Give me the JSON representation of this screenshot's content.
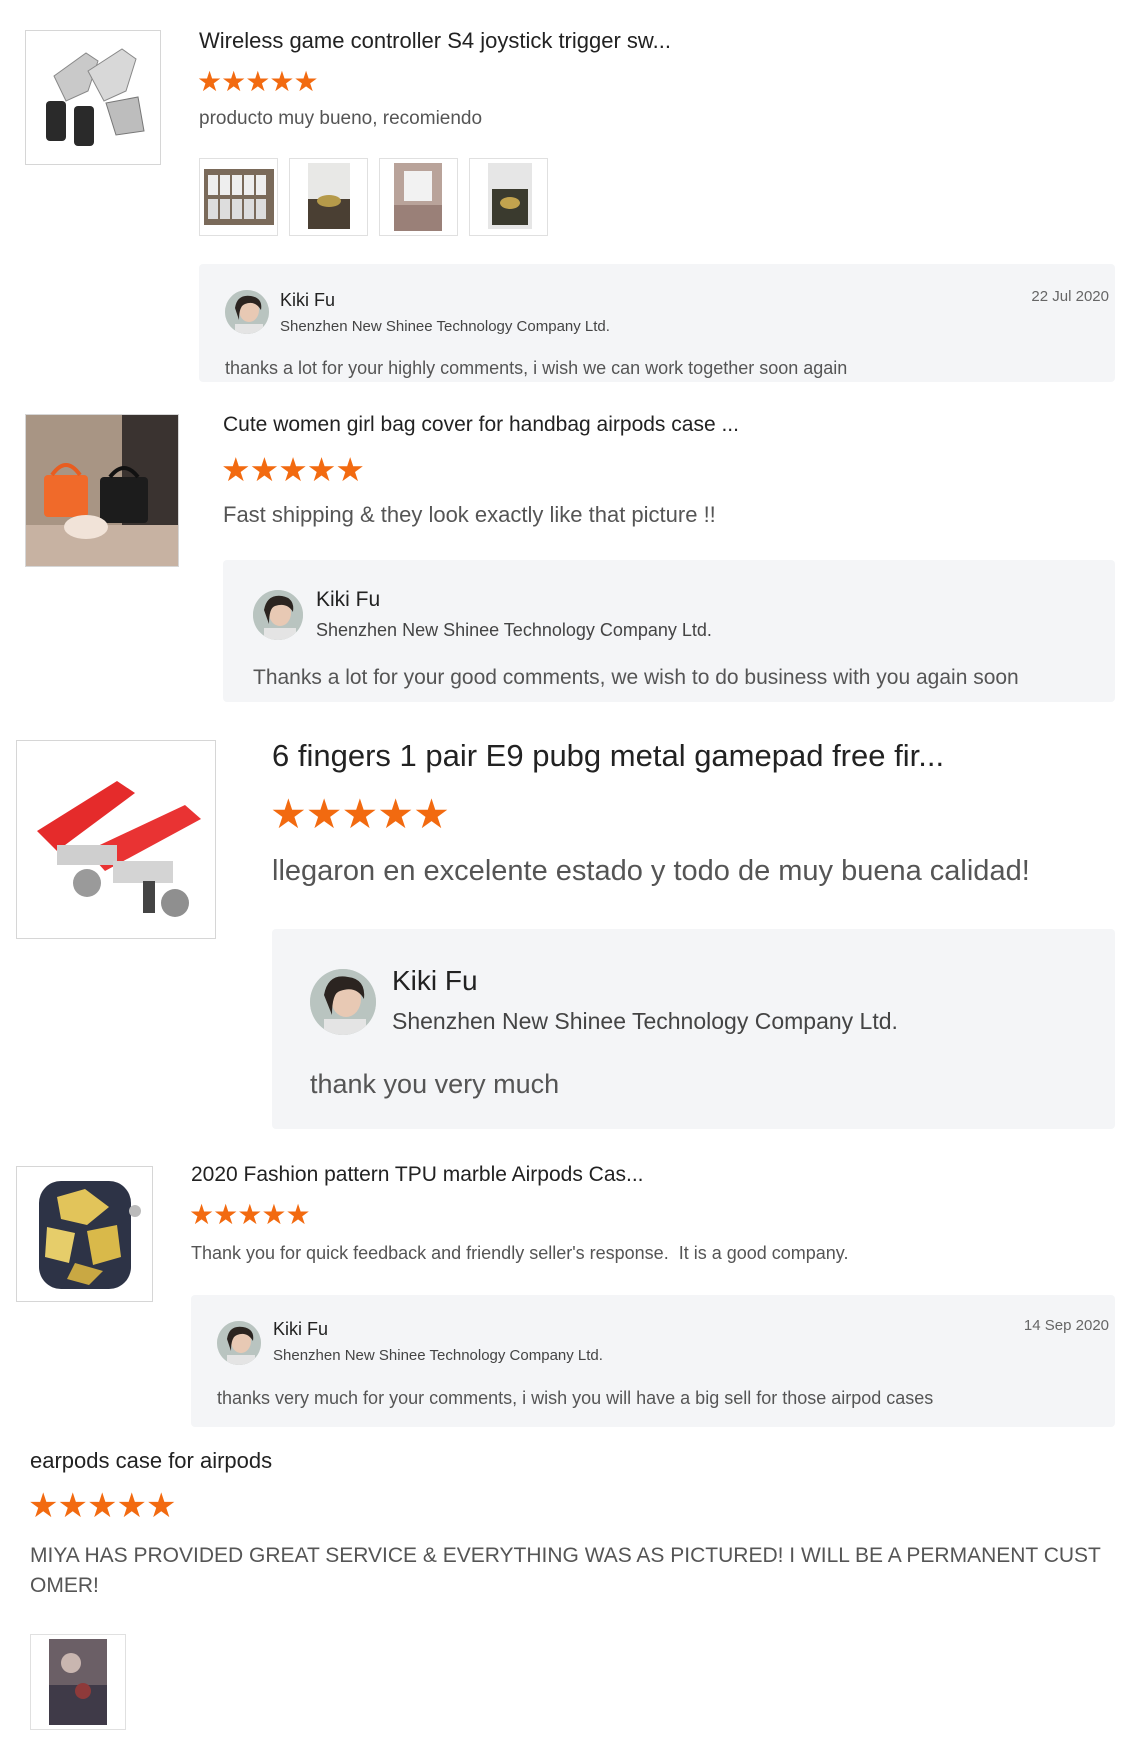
{
  "colors": {
    "star": "#f26a10",
    "reply_bg": "#f4f5f7"
  },
  "reviews": [
    {
      "product_title": "Wireless game controller S4 joystick trigger sw...",
      "product_image": "gamepad-trigger-silver",
      "rating": 5,
      "comment": "producto muy bueno, recomiendo",
      "photos": [
        "boxes-photo",
        "gold-trigger-photo",
        "pink-box-photo",
        "gold-trigger-box-photo"
      ],
      "reply": {
        "name": "Kiki Fu",
        "company": "Shenzhen New Shinee Technology Company Ltd.",
        "date": "22 Jul 2020",
        "text": "thanks a lot for your highly comments, i wish we can work together soon again"
      }
    },
    {
      "product_title": "Cute women girl bag cover for handbag airpods case ...",
      "product_image": "handbag-airpods-case",
      "rating": 5,
      "comment": "Fast shipping & they look exactly like that picture !!",
      "reply": {
        "name": "Kiki Fu",
        "company": "Shenzhen New Shinee Technology Company Ltd.",
        "text": "Thanks a lot for your good comments, we wish to do business with you again soon"
      }
    },
    {
      "product_title": "6 fingers 1 pair E9 pubg metal gamepad free fir...",
      "product_image": "gamepad-trigger-red",
      "rating": 5,
      "comment": "llegaron en excelente estado y todo de muy buena calidad!",
      "reply": {
        "name": "Kiki Fu",
        "company": "Shenzhen New Shinee Technology Company Ltd.",
        "text": "thank you very much"
      }
    },
    {
      "product_title": "2020 Fashion pattern TPU marble Airpods Cas...",
      "product_image": "marble-airpods-case",
      "rating": 5,
      "comment": "Thank you for quick feedback and friendly seller's response.  It is a good company.",
      "reply": {
        "name": "Kiki Fu",
        "company": "Shenzhen New Shinee Technology Company Ltd.",
        "date": "14 Sep 2020",
        "text": "thanks very much for your comments, i wish you will have a big sell for those airpod cases"
      }
    },
    {
      "product_title": "earpods case for airpods",
      "rating": 5,
      "comment_line1": "MIYA HAS PROVIDED GREAT SERVICE & EVERYTHING WAS AS PICTURED! I WILL BE A PERMANENT CUST",
      "comment_line2": "OMER!",
      "photos": [
        "case-photo"
      ]
    }
  ]
}
